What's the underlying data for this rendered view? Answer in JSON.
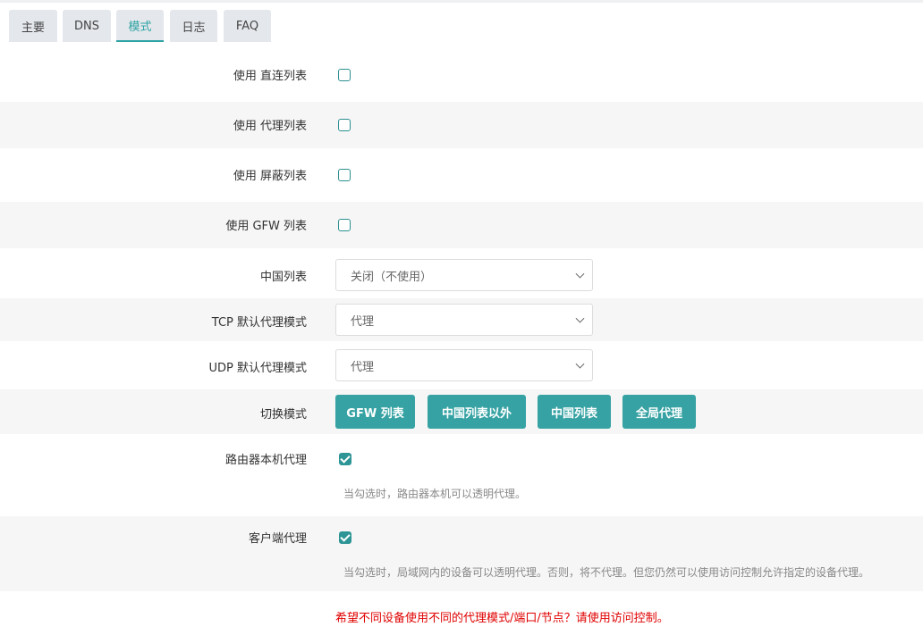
{
  "tabs": [
    {
      "label": "主要",
      "active": false
    },
    {
      "label": "DNS",
      "active": false
    },
    {
      "label": "模式",
      "active": true
    },
    {
      "label": "日志",
      "active": false
    },
    {
      "label": "FAQ",
      "active": false
    }
  ],
  "rows": {
    "direct_list": {
      "label": "使用 直连列表",
      "checked": false
    },
    "proxy_list": {
      "label": "使用 代理列表",
      "checked": false
    },
    "block_list": {
      "label": "使用 屏蔽列表",
      "checked": false
    },
    "gfw_list": {
      "label": "使用 GFW 列表",
      "checked": false
    },
    "china_list": {
      "label": "中国列表",
      "selected": "关闭（不使用）"
    },
    "tcp_mode": {
      "label": "TCP 默认代理模式",
      "selected": "代理"
    },
    "udp_mode": {
      "label": "UDP 默认代理模式",
      "selected": "代理"
    },
    "switch_mode": {
      "label": "切换模式",
      "buttons": [
        "GFW 列表",
        "中国列表以外",
        "中国列表",
        "全局代理"
      ]
    },
    "router_proxy": {
      "label": "路由器本机代理",
      "checked": true,
      "hint": "当勾选时，路由器本机可以透明代理。"
    },
    "client_proxy": {
      "label": "客户端代理",
      "checked": true,
      "hint": "当勾选时，局域网内的设备可以透明代理。否则，将不代理。但您仍然可以使用访问控制允许指定的设备代理。"
    }
  },
  "warning": "希望不同设备使用不同的代理模式/端口/节点？请使用访问控制。",
  "colors": {
    "accent": "#36a2a3",
    "warning": "#e00000"
  }
}
